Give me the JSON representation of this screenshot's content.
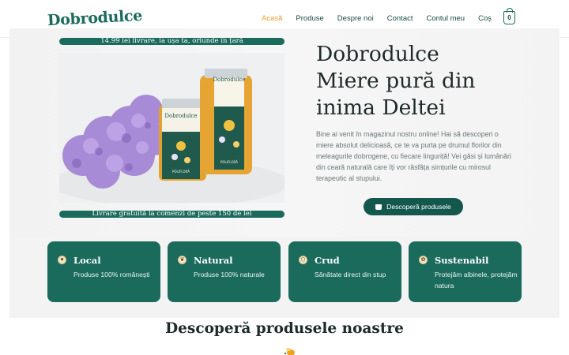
{
  "header": {
    "logo": "Dobrodulce",
    "nav": [
      "Acasă",
      "Produse",
      "Despre noi",
      "Contact",
      "Contul meu",
      "Coș"
    ],
    "active": "Acasă",
    "cart_count": "0"
  },
  "hero": {
    "banner_top": "14.99 lei livrare, la ușa ta, oriunde în țară",
    "banner_bottom": "Livrare gratuită la comenzi de peste 150 de lei",
    "title_line1": "Dobrodulce",
    "title_line2": "Miere pură din",
    "title_line3": "inima Deltei",
    "description": "Bine ai venit în magazinul nostru online! Hai să descoperi o miere absolut delicioasă, ce te va purta pe drumul florilor din meleagurile dobrogene, cu fiecare linguriță! Vei găsi și lumânări din ceară naturală care îți vor răsfăța simțurile cu mirosul terapeutic al stupului.",
    "cta": "Descoperă produsele",
    "jar_label": "Dobrodulce",
    "jar_sublabel": "POLIFLORĂ"
  },
  "features": [
    {
      "title": "Local",
      "text": "Produse 100% românești",
      "icon": "heart-icon"
    },
    {
      "title": "Natural",
      "text": "Produse 100% naturale",
      "icon": "leaf-icon"
    },
    {
      "title": "Crud",
      "text": "Sănătate direct din stup",
      "icon": "honeycomb-icon"
    },
    {
      "title": "Sustenabil",
      "text": "Protejăm albinele, protejăm natura",
      "icon": "bee-icon"
    }
  ],
  "section": {
    "title": "Descoperă produsele noastre"
  },
  "colors": {
    "primary": "#1a6b5c",
    "button": "#13574d",
    "accent": "#e3a23a"
  }
}
